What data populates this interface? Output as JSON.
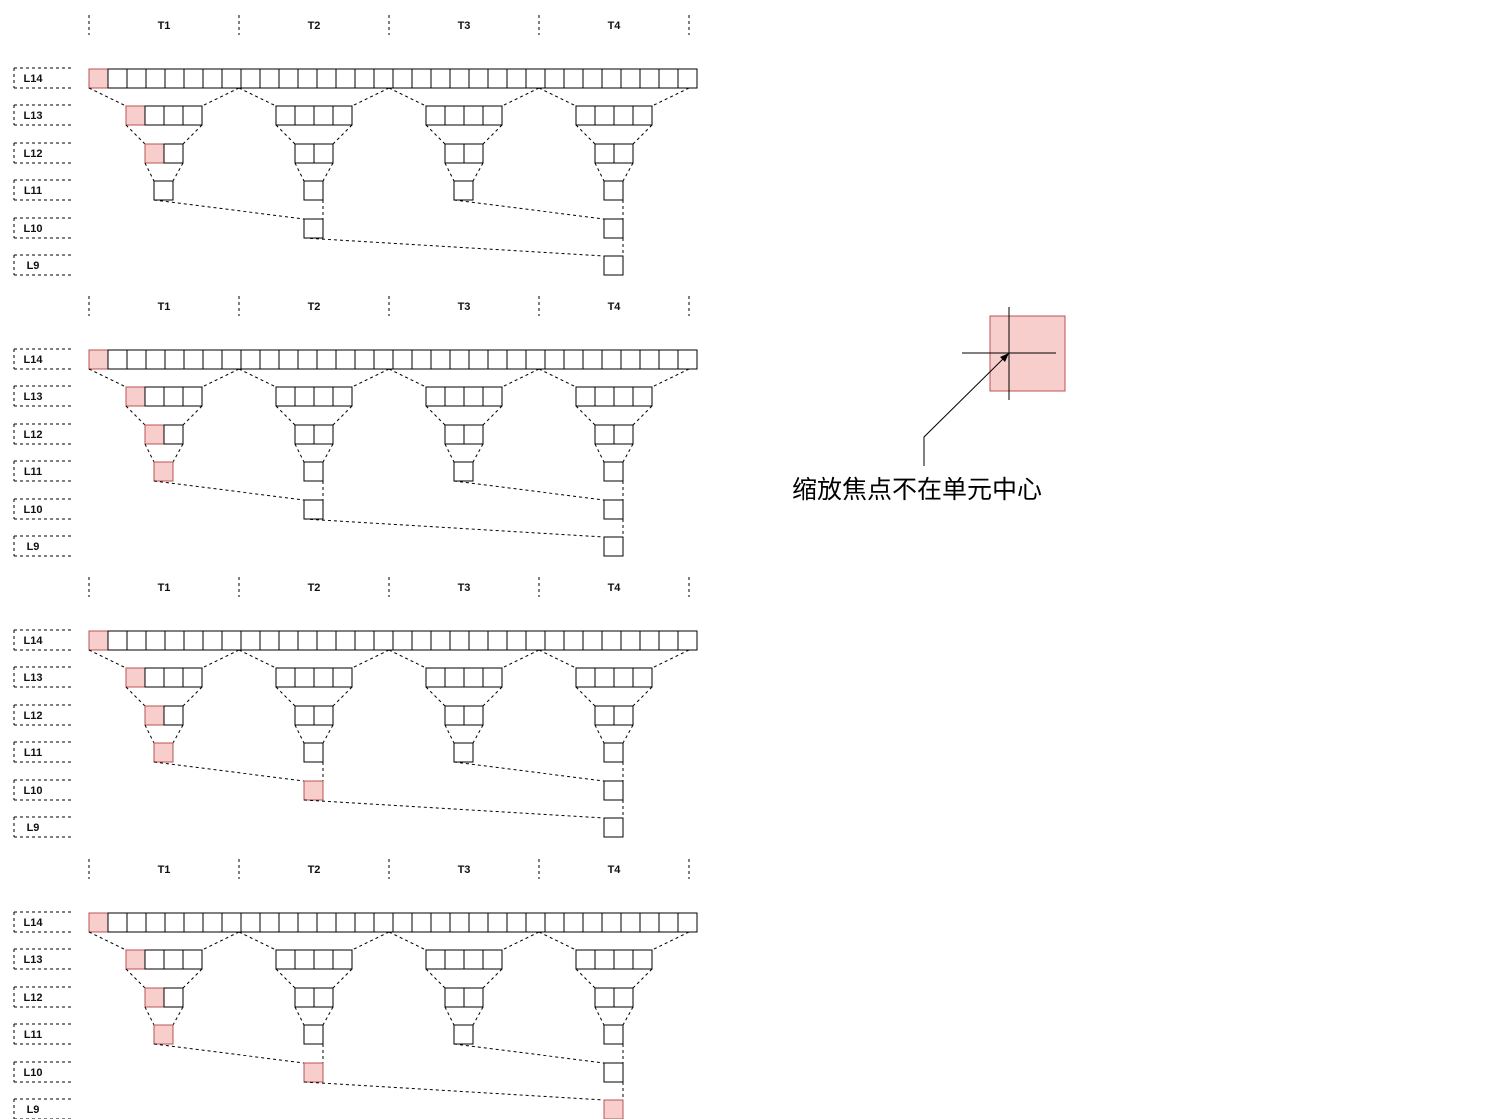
{
  "colors": {
    "highlight_fill": "#f8cecc",
    "highlight_stroke": "#b85450",
    "cell_stroke": "#000000",
    "background": "#ffffff"
  },
  "level_labels": [
    "L14",
    "L13",
    "L12",
    "L11",
    "L10",
    "L9"
  ],
  "tile_labels": [
    "T1",
    "T2",
    "T3",
    "T4"
  ],
  "diagrams": [
    {
      "highlights": {
        "L14": [
          0
        ],
        "L13": [
          0
        ],
        "L12": [
          0
        ],
        "L11": [],
        "L10": [],
        "L9": []
      }
    },
    {
      "highlights": {
        "L14": [
          0
        ],
        "L13": [
          0
        ],
        "L12": [
          0
        ],
        "L11": [
          0
        ],
        "L10": [],
        "L9": []
      }
    },
    {
      "highlights": {
        "L14": [
          0
        ],
        "L13": [
          0
        ],
        "L12": [
          0
        ],
        "L11": [
          0
        ],
        "L10": [
          0
        ],
        "L9": []
      }
    },
    {
      "highlights": {
        "L14": [
          0
        ],
        "L13": [
          0
        ],
        "L12": [
          0
        ],
        "L11": [
          0
        ],
        "L10": [
          0
        ],
        "L9": [
          0
        ]
      }
    }
  ],
  "annotation": {
    "text": "缩放焦点不在单元中心"
  }
}
